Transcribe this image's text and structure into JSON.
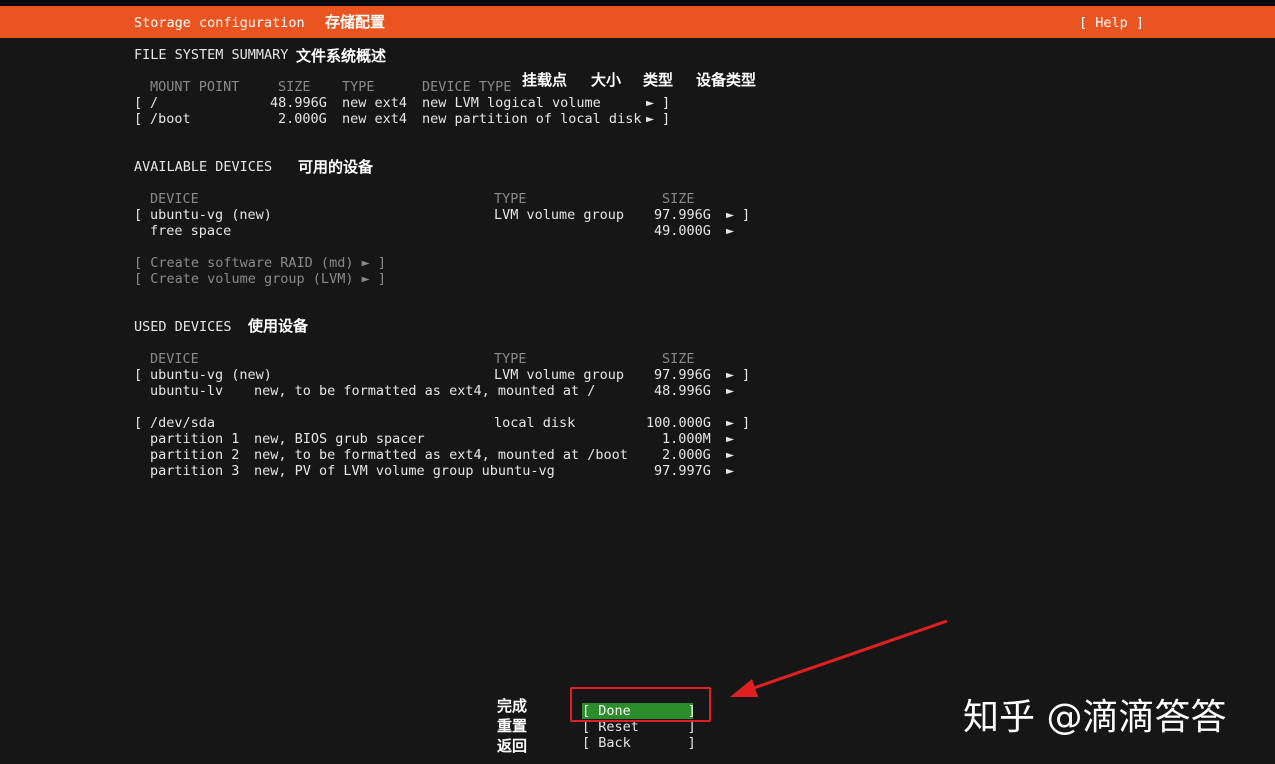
{
  "header": {
    "title": "Storage configuration",
    "title_cn": "存储配置",
    "help": "[ Help ]"
  },
  "fs_summary": {
    "heading": "FILE SYSTEM SUMMARY",
    "heading_cn": "文件系统概述",
    "col_mount": "MOUNT POINT",
    "col_size": "SIZE",
    "col_type": "TYPE",
    "col_devtype": "DEVICE TYPE",
    "col_mount_cn": "挂载点",
    "col_size_cn": "大小",
    "col_type_cn": "类型",
    "col_devtype_cn": "设备类型",
    "rows": [
      {
        "open": "[",
        "mount": "/",
        "size": "48.996G",
        "type": "new ext4",
        "devtype": "new LVM logical volume",
        "arrow": "►",
        "close": "]"
      },
      {
        "open": "[",
        "mount": "/boot",
        "size": "2.000G",
        "type": "new ext4",
        "devtype": "new partition of local disk",
        "arrow": "►",
        "close": "]"
      }
    ]
  },
  "available": {
    "heading": "AVAILABLE DEVICES",
    "heading_cn": "可用的设备",
    "col_device": "DEVICE",
    "col_type": "TYPE",
    "col_size": "SIZE",
    "rows": [
      {
        "open": "[",
        "device": "ubuntu-vg (new)",
        "type": "LVM volume group",
        "size": "97.996G",
        "arrow": "►",
        "close": "]"
      },
      {
        "device": "free space",
        "size": "49.000G",
        "arrow": "►"
      }
    ],
    "actions": [
      "[ Create software RAID (md) ► ]",
      "[ Create volume group (LVM) ► ]"
    ]
  },
  "used": {
    "heading": "USED DEVICES",
    "heading_cn": "使用设备",
    "col_device": "DEVICE",
    "col_type": "TYPE",
    "col_size": "SIZE",
    "vg": {
      "open": "[",
      "device": "ubuntu-vg (new)",
      "type": "LVM volume group",
      "size": "97.996G",
      "arrow": "►",
      "close": "]"
    },
    "lv": {
      "name": "ubuntu-lv",
      "desc": "new, to be formatted as ext4, mounted at /",
      "size": "48.996G",
      "arrow": "►"
    },
    "sda": {
      "open": "[",
      "device": "/dev/sda",
      "type": "local disk",
      "size": "100.000G",
      "arrow": "►",
      "close": "]"
    },
    "partitions": [
      {
        "name": "partition 1",
        "desc": "new, BIOS grub spacer",
        "size": "1.000M",
        "arrow": "►"
      },
      {
        "name": "partition 2",
        "desc": "new, to be formatted as ext4, mounted at /boot",
        "size": "2.000G",
        "arrow": "►"
      },
      {
        "name": "partition 3",
        "desc": "new, PV of LVM volume group ubuntu-vg",
        "size": "97.997G",
        "arrow": "►"
      }
    ]
  },
  "buttons": {
    "done": "[ Done       ]",
    "reset": "[ Reset      ]",
    "back": "[ Back       ]",
    "done_cn": "完成",
    "reset_cn": "重置",
    "back_cn": "返回"
  },
  "watermark": "知乎 @滴滴答答",
  "colors": {
    "header": "#e95420",
    "background": "#161616",
    "done_button": "#2b8c2b",
    "annotation": "#e02020"
  }
}
